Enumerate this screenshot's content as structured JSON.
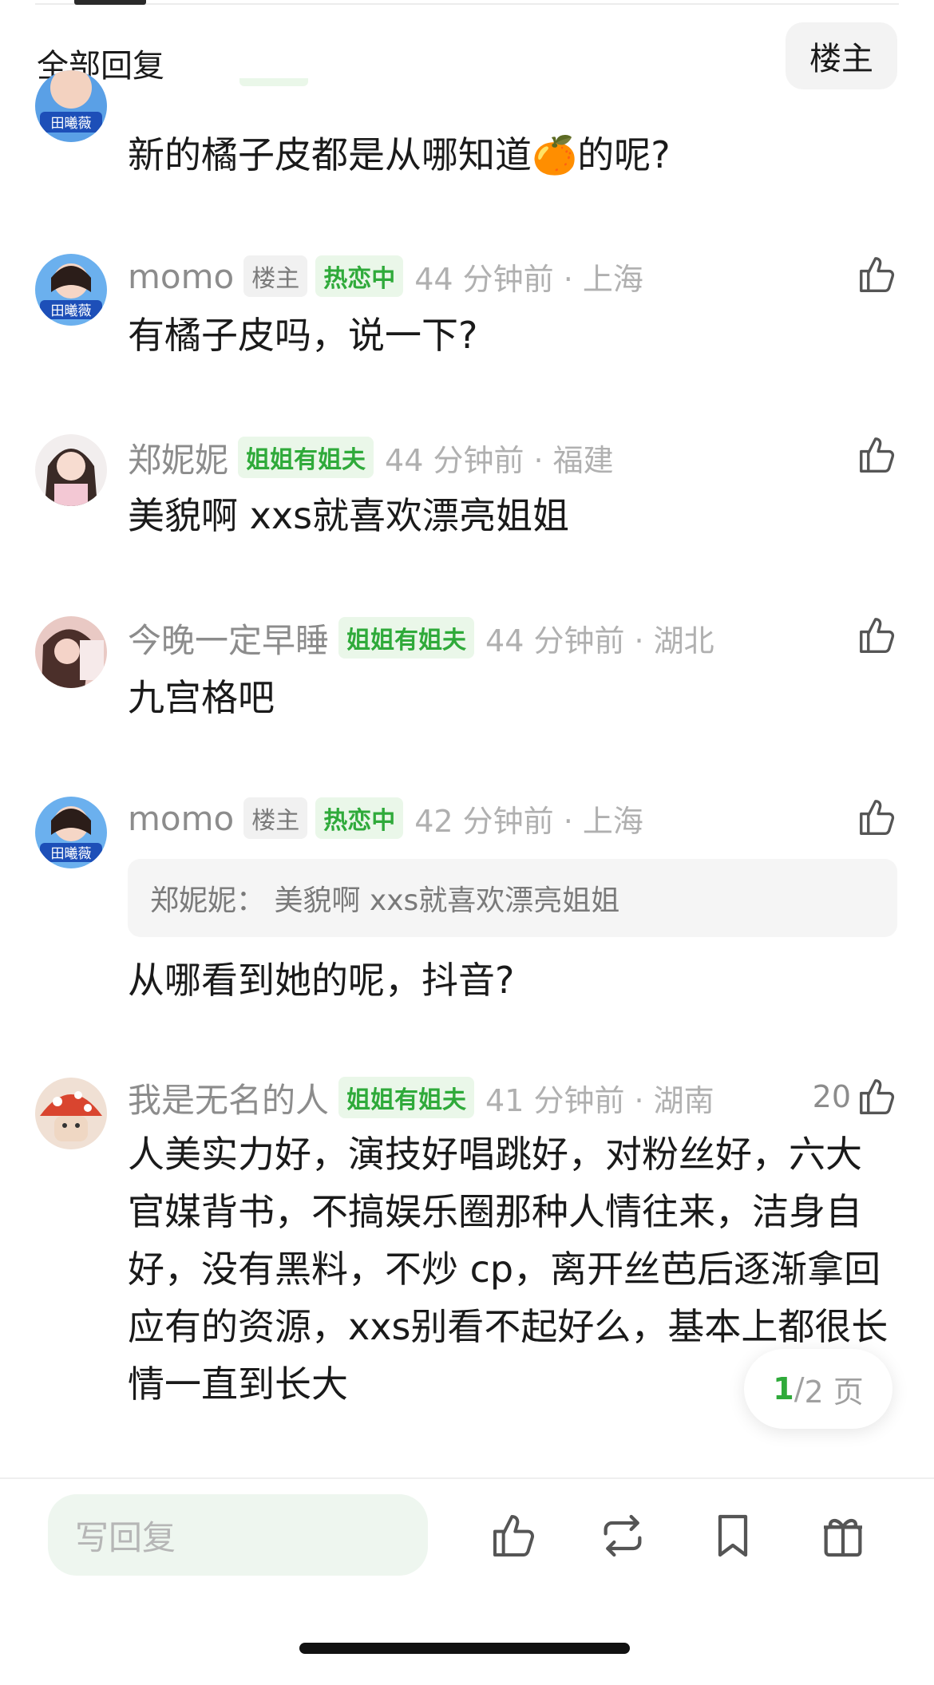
{
  "header": {
    "title": "全部回复",
    "filter_label": "楼主"
  },
  "comments": [
    {
      "username": "",
      "host_badge": "",
      "tag": "",
      "time": "",
      "quote": "",
      "text": "新的橘子皮都是从哪知道🍊的呢?",
      "likes": "",
      "avatar_label": "田曦薇"
    },
    {
      "username": "momo",
      "host_badge": "楼主",
      "tag": "热恋中",
      "time": "44 分钟前 · 上海",
      "text": "有橘子皮吗，说一下?",
      "likes": "",
      "avatar_label": "田曦薇"
    },
    {
      "username": "郑妮妮",
      "host_badge": "",
      "tag": "姐姐有姐夫",
      "time": "44 分钟前 · 福建",
      "text": "美貌啊 xxs就喜欢漂亮姐姐",
      "likes": ""
    },
    {
      "username": "今晚一定早睡",
      "host_badge": "",
      "tag": "姐姐有姐夫",
      "time": "44 分钟前 · 湖北",
      "text": "九宫格吧",
      "likes": ""
    },
    {
      "username": "momo",
      "host_badge": "楼主",
      "tag": "热恋中",
      "time": "42 分钟前 · 上海",
      "quote": "郑妮妮：  美貌啊 xxs就喜欢漂亮姐姐",
      "text": "从哪看到她的呢，抖音?",
      "likes": "",
      "avatar_label": "田曦薇"
    },
    {
      "username": "我是无名的人",
      "host_badge": "",
      "tag": "姐姐有姐夫",
      "time": "41 分钟前 · 湖南",
      "text": "人美实力好，演技好唱跳好，对粉丝好，六大官媒背书，不搞娱乐圈那种人情往来，洁身自好，没有黑料，不炒 cp，离开丝芭后逐渐拿回应有的资源，xxs别看不起好么，基本上都很长情一直到长大",
      "likes": "20"
    }
  ],
  "pagination": {
    "current": "1",
    "separator": "/",
    "total": "2 页"
  },
  "bottom_bar": {
    "reply_placeholder": "写回复",
    "icons": [
      "like-icon",
      "repost-icon",
      "bookmark-icon",
      "gift-icon"
    ]
  },
  "colors": {
    "accent_green": "#2faa3a",
    "tag_bg": "#eaf7e9",
    "meta_gray": "#8c8c8c"
  }
}
